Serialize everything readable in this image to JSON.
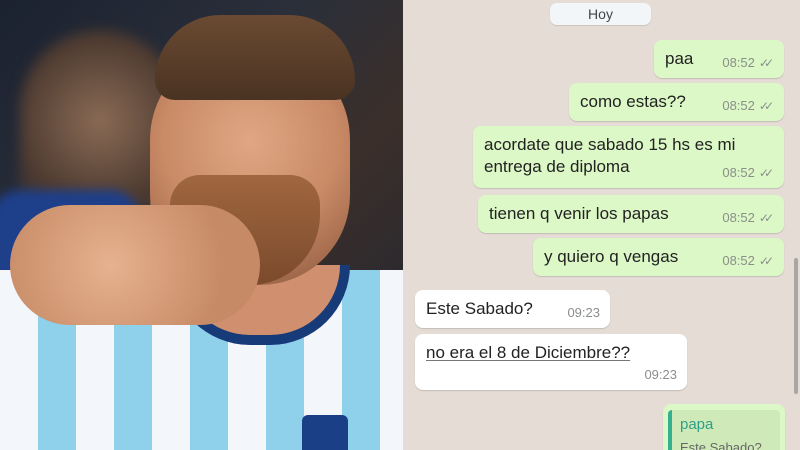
{
  "chat": {
    "date_label": "Hoy",
    "messages": [
      {
        "dir": "out",
        "text": "paa",
        "time": "08:52"
      },
      {
        "dir": "out",
        "text": "como estas??",
        "time": "08:52"
      },
      {
        "dir": "out",
        "text_line1": "acordate que sabado 15 hs es mi",
        "text_line2": "entrega de diploma",
        "time": "08:52"
      },
      {
        "dir": "out",
        "text": "tienen q venir los papas",
        "time": "08:52"
      },
      {
        "dir": "out",
        "text": "y quiero q vengas",
        "time": "08:52"
      },
      {
        "dir": "in",
        "text": "Este Sabado?",
        "time": "09:23"
      },
      {
        "dir": "in",
        "text": "no era el 8 de Diciembre??",
        "time": "09:23"
      }
    ],
    "reply_preview": {
      "author": "papa",
      "text": "Este Sabado?"
    }
  },
  "icons": {
    "read_receipt": "double-check-icon"
  },
  "colors": {
    "outgoing_bubble": "#dcf8c6",
    "incoming_bubble": "#ffffff",
    "chat_background": "#e5ddd5",
    "quote_accent": "#35b08f"
  }
}
